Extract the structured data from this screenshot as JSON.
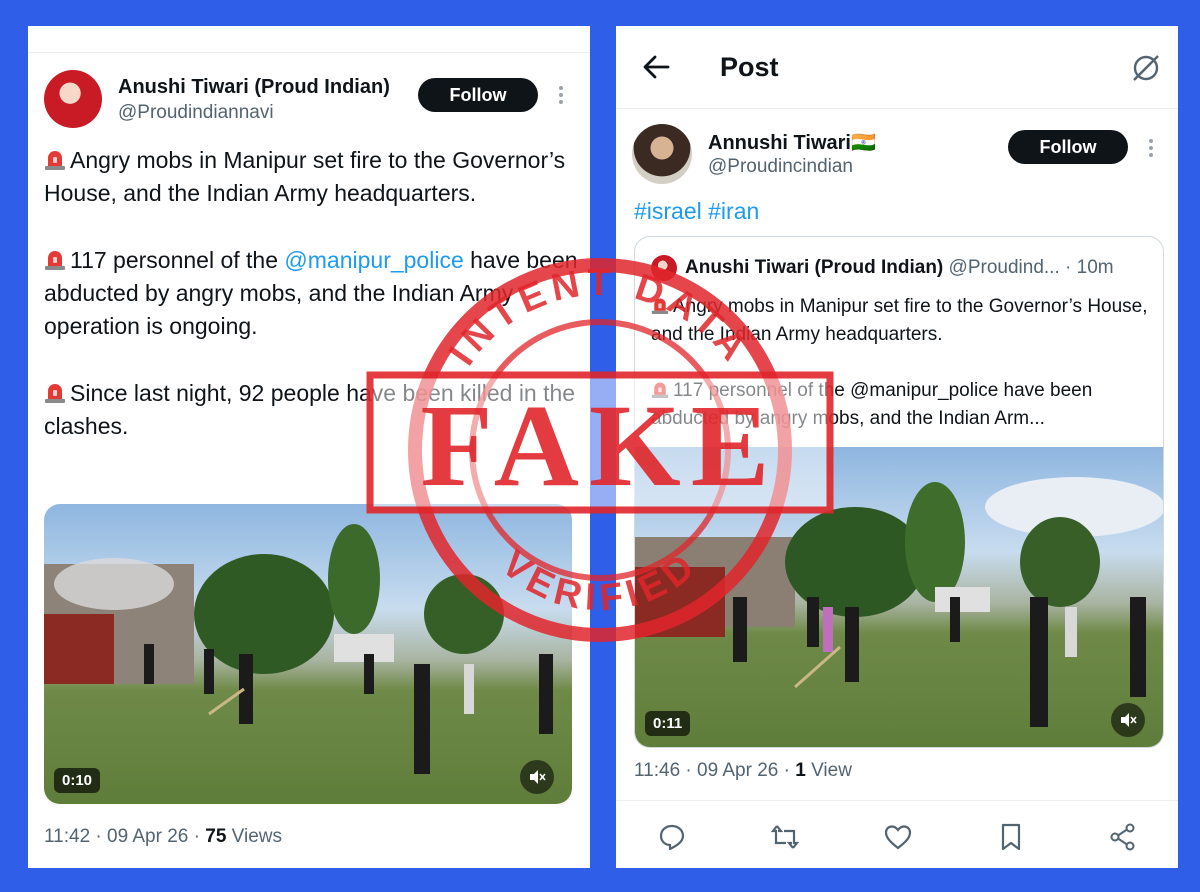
{
  "left_post": {
    "author_name": "Anushi Tiwari (Proud Indian)",
    "author_handle": "@Proudindiannavi",
    "follow_label": "Follow",
    "paragraph1": "Angry mobs in Manipur set fire to the Governor’s House, and the Indian Army headquarters.",
    "paragraph2_pre": "117 personnel of the ",
    "paragraph2_mention": "@manipur_police",
    "paragraph2_post": " have been abducted by angry mobs, and the Indian Army operation is ongoing.",
    "paragraph3": "Since last night, 92 people have been killed in the clashes.",
    "video_duration": "0:10",
    "meta_time": "11:42 · 09 Apr 26 · ",
    "meta_views_count": "75",
    "meta_views_label": " Views"
  },
  "right_post": {
    "header_title": "Post",
    "author_name": "Annushi Tiwari🇮🇳",
    "author_handle": "@Proudincindian",
    "follow_label": "Follow",
    "hashtags": "#israel #iran",
    "quoted": {
      "author_name": "Anushi Tiwari (Proud Indian)",
      "author_handle": "@Proudind...",
      "time": "· 10m",
      "paragraph1": "Angry mobs in Manipur set fire to the Governor’s House, and the Indian Army headquarters.",
      "paragraph2": "117 personnel of the @manipur_police have been abducted by angry mobs, and the Indian Arm..."
    },
    "video_duration": "0:11",
    "meta_time": "11:46 · 09 Apr 26 · ",
    "meta_views_count": "1",
    "meta_views_label": " View"
  },
  "stamp": {
    "main_text": "FAKE",
    "top_arc_text": "INTENT DATA",
    "bottom_arc_text": "VERIFIED"
  },
  "colors": {
    "background": "#2f5ee8",
    "link": "#1d9bf0",
    "stamp_red": "#e0262b"
  },
  "icons": [
    "siren-icon",
    "back-arrow-icon",
    "grok-icon",
    "more-icon",
    "mute-icon",
    "reply-icon",
    "retweet-icon",
    "like-icon",
    "bookmark-icon",
    "share-icon"
  ]
}
